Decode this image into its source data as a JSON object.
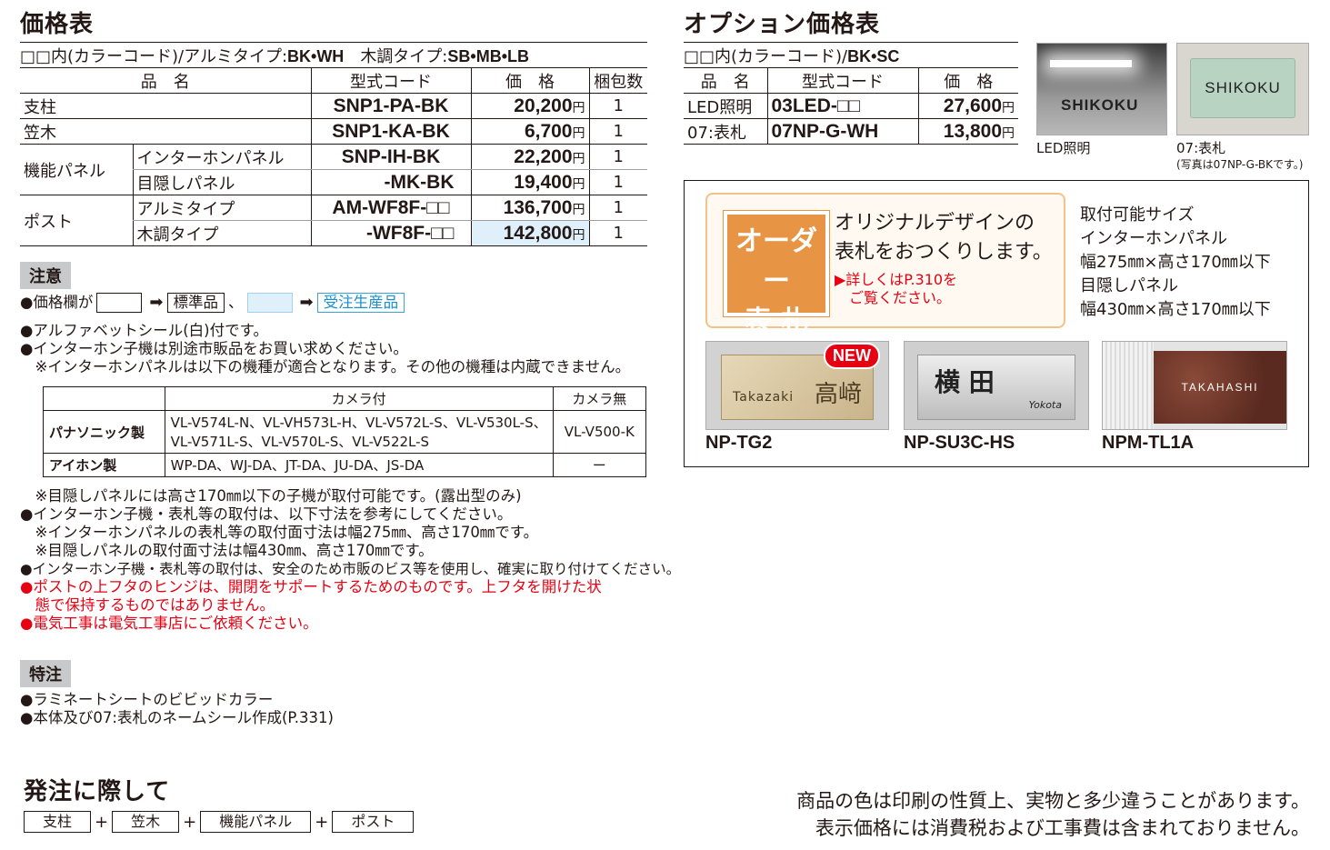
{
  "price_table": {
    "title": "価格表",
    "subtitle": "□□内(カラーコード)/アルミタイプ:",
    "colors_alumi": "BK•WH",
    "subtitle_mokuchou": "木調タイプ:",
    "colors_mokuchou": "SB•MB•LB",
    "headers": {
      "name": "品　名",
      "code": "型式コード",
      "price": "価　格",
      "qty": "梱包数"
    },
    "rows": [
      {
        "name": "支柱",
        "sub": "",
        "code": "SNP1-PA-BK",
        "price": "20,200",
        "unit": "円",
        "qty": "1"
      },
      {
        "name": "笠木",
        "sub": "",
        "code": "SNP1-KA-BK",
        "price": "6,700",
        "unit": "円",
        "qty": "1"
      },
      {
        "name": "機能パネル",
        "sub": "インターホンパネル",
        "code": "SNP-IH-BK",
        "price": "22,200",
        "unit": "円",
        "qty": "1"
      },
      {
        "name": "",
        "sub": "目隠しパネル",
        "code": "-MK-BK",
        "price": "19,400",
        "unit": "円",
        "qty": "1"
      },
      {
        "name": "ポスト",
        "sub": "アルミタイプ",
        "code": "AM-WF8F-□□",
        "price": "136,700",
        "unit": "円",
        "qty": "1"
      },
      {
        "name": "",
        "sub": "木調タイプ",
        "code": "-WF8F-□□",
        "price": "142,800",
        "unit": "円",
        "qty": "1"
      }
    ]
  },
  "option_table": {
    "title": "オプション価格表",
    "subtitle": "□□内(カラーコード)/",
    "colors": "BK•SC",
    "headers": {
      "name": "品　名",
      "code": "型式コード",
      "price": "価　格"
    },
    "rows": [
      {
        "name": "LED照明",
        "code": "03LED-□□",
        "price": "27,600",
        "unit": "円"
      },
      {
        "name": "07:表札",
        "code": "07NP-G-WH",
        "price": "13,800",
        "unit": "円"
      }
    ],
    "photo_led_caption": "LED照明",
    "photo_led_sign": "SHIKOKU",
    "photo_nameplate_caption": "07:表札",
    "photo_nameplate_note": "(写真は07NP-G-BKです。)",
    "photo_nameplate_sign": "SHIKOKU"
  },
  "order_box": {
    "badge_line1": "オーダー",
    "badge_line2": "表 札",
    "headline1": "オリジナルデザインの",
    "headline2": "表札をおつくりします。",
    "link1": "▶詳しくはP.310を",
    "link2": "ご覧ください。",
    "size_title": "取付可能サイズ",
    "size_ih_label": "インターホンパネル",
    "size_ih": "幅275㎜×高さ170㎜以下",
    "size_mk_label": "目隠しパネル",
    "size_mk": "幅430㎜×高さ170㎜以下",
    "new_badge": "NEW",
    "plates": [
      {
        "label": "NP-TG2",
        "text_latin": "Takazaki",
        "text_jp": "高﨑"
      },
      {
        "label": "NP-SU3C-HS",
        "text_latin": "Yokota",
        "text_jp": "横 田"
      },
      {
        "label": "NPM-TL1A",
        "text_latin": "TAKAHASHI",
        "text_jp": ""
      }
    ]
  },
  "notes": {
    "caution_tag": "注意",
    "legend_prefix": "●価格欄が",
    "legend_std": "標準品",
    "legend_sep": "、",
    "legend_order": "受注生産品",
    "lines_a": [
      "●アルファベットシール(白)付です。",
      "●インターホン子機は別途市販品をお買い求めください。",
      "　※インターホンパネルは以下の機種が適合となります。その他の機種は内蔵できません。"
    ],
    "camera_table": {
      "h_camera": "カメラ付",
      "h_no_camera": "カメラ無",
      "r1_maker": "パナソニック製",
      "r1_cam_line1": "VL-V574L-N、VL-VH573L-H、VL-V572L-S、VL-V530L-S、",
      "r1_cam_line2": "VL-V571L-S、VL-V570L-S、VL-V522L-S",
      "r1_nocam": "VL-V500-K",
      "r2_maker": "アイホン製",
      "r2_cam": "WP-DA、WJ-DA、JT-DA、JU-DA、JS-DA",
      "r2_nocam": "ー"
    },
    "lines_b": [
      "　※目隠しパネルには高さ170㎜以下の子機が取付可能です。(露出型のみ)",
      "●インターホン子機・表札等の取付は、以下寸法を参考にしてください。",
      "　※インターホンパネルの表札等の取付面寸法は幅275㎜、高さ170㎜です。",
      "　※目隠しパネルの取付面寸法は幅430㎜、高さ170㎜です。",
      "●インターホン子機・表札等の取付は、安全のため市販のビス等を使用し、確実に取り付けてください。"
    ],
    "red_lines": [
      "●ポストの上フタのヒンジは、開閉をサポートするためのものです。上フタを開けた状",
      "　態で保持するものではありません。",
      "●電気工事は電気工事店にご依頼ください。"
    ],
    "special_tag": "特注",
    "special_lines": [
      "●ラミネートシートのビビッドカラー",
      "●本体及び07:表札のネームシール作成(P.331)"
    ]
  },
  "ordering": {
    "title": "発注に際して",
    "items": [
      "支柱",
      "笠木",
      "機能パネル",
      "ポスト"
    ],
    "plus": "+"
  },
  "footer": {
    "line1": "商品の色は印刷の性質上、実物と多少違うことがあります。",
    "line2": "表示価格には消費税および工事費は含まれておりません。"
  },
  "colors": {
    "blue_cell": "#dff0fb",
    "red": "#e60012",
    "orange_border": "#f3c28a",
    "badge": "#e89445"
  }
}
